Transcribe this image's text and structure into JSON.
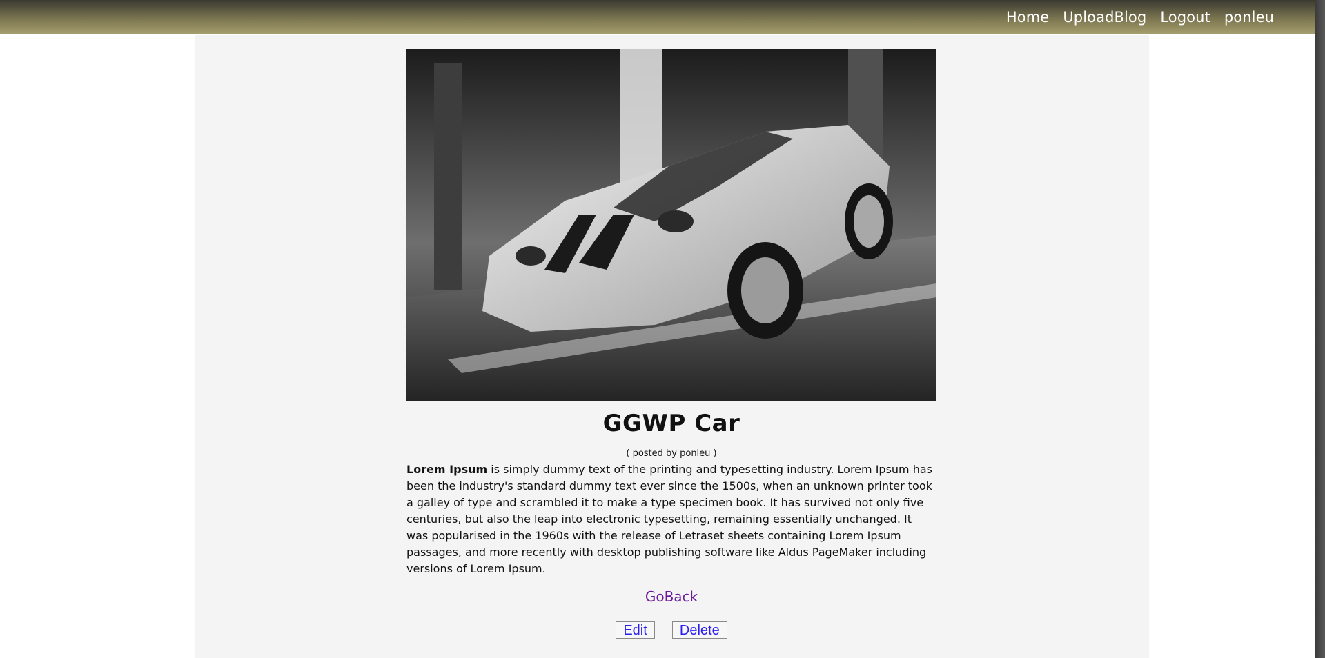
{
  "nav": {
    "items": [
      {
        "label": "Home"
      },
      {
        "label": "UploadBlog"
      },
      {
        "label": "Logout"
      },
      {
        "label": "ponleu"
      }
    ]
  },
  "post": {
    "image_alt": "Black and white photo of a white sports car with racing stripes",
    "title": "GGWP Car",
    "posted_by": "( posted by ponleu )",
    "body_lead": "Lorem Ipsum",
    "body_rest": " is simply dummy text of the printing and typesetting industry. Lorem Ipsum has been the industry's standard dummy text ever since the 1500s, when an unknown printer took a galley of type and scrambled it to make a type specimen book. It has survived not only five centuries, but also the leap into electronic typesetting, remaining essentially unchanged. It was popularised in the 1960s with the release of Letraset sheets containing Lorem Ipsum passages, and more recently with desktop publishing software like Aldus PageMaker including versions of Lorem Ipsum.",
    "goback_label": "GoBack",
    "edit_label": "Edit",
    "delete_label": "Delete"
  },
  "colors": {
    "link": "#6a1b9a",
    "button_text": "#2b1ff0",
    "panel_bg": "#f4f4f4"
  }
}
